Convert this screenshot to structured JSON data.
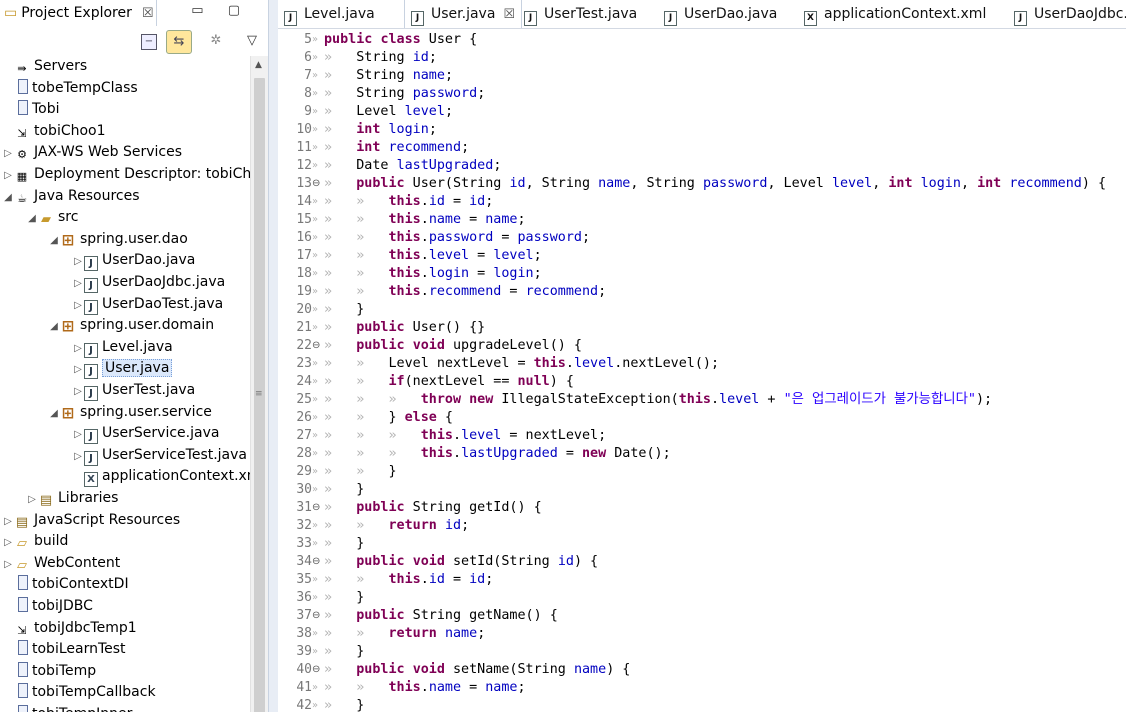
{
  "explorer": {
    "title": "Project Explorer",
    "close_glyph": "☒",
    "minmax": "▭ ▢",
    "tree": [
      {
        "label": "Servers",
        "twisty": "",
        "icon": "server",
        "depth": 0
      },
      {
        "label": "tobeTempClass",
        "twisty": "",
        "icon": "project",
        "depth": 0
      },
      {
        "label": "Tobi",
        "twisty": "",
        "icon": "project",
        "depth": 0
      },
      {
        "label": "tobiChoo1",
        "twisty": "",
        "icon": "project-web",
        "depth": 0
      },
      {
        "label": "JAX-WS Web Services",
        "twisty": "▷",
        "icon": "webservice",
        "depth": 0
      },
      {
        "label": "Deployment Descriptor: tobiCh",
        "twisty": "▷",
        "icon": "descriptor",
        "depth": 0
      },
      {
        "label": "Java Resources",
        "twisty": "◢",
        "icon": "java-resources",
        "depth": 0
      },
      {
        "label": "src",
        "twisty": "◢",
        "icon": "src-folder",
        "depth": 1
      },
      {
        "label": "spring.user.dao",
        "twisty": "◢",
        "icon": "package",
        "depth": 2
      },
      {
        "label": "UserDao.java",
        "twisty": "▷",
        "icon": "java-file",
        "depth": 3
      },
      {
        "label": "UserDaoJdbc.java",
        "twisty": "▷",
        "icon": "java-file",
        "depth": 3
      },
      {
        "label": "UserDaoTest.java",
        "twisty": "▷",
        "icon": "java-file",
        "depth": 3
      },
      {
        "label": "spring.user.domain",
        "twisty": "◢",
        "icon": "package",
        "depth": 2
      },
      {
        "label": "Level.java",
        "twisty": "▷",
        "icon": "java-file",
        "depth": 3
      },
      {
        "label": "User.java",
        "twisty": "▷",
        "icon": "java-file",
        "depth": 3,
        "selected": true
      },
      {
        "label": "UserTest.java",
        "twisty": "▷",
        "icon": "java-file",
        "depth": 3
      },
      {
        "label": "spring.user.service",
        "twisty": "◢",
        "icon": "package",
        "depth": 2
      },
      {
        "label": "UserService.java",
        "twisty": "▷",
        "icon": "java-file",
        "depth": 3
      },
      {
        "label": "UserServiceTest.java",
        "twisty": "▷",
        "icon": "java-file",
        "depth": 3
      },
      {
        "label": "applicationContext.xml",
        "twisty": "",
        "icon": "xml-file",
        "depth": 3
      },
      {
        "label": "Libraries",
        "twisty": "▷",
        "icon": "libraries",
        "depth": 1
      },
      {
        "label": "JavaScript Resources",
        "twisty": "▷",
        "icon": "js-resources",
        "depth": 0
      },
      {
        "label": "build",
        "twisty": "▷",
        "icon": "folder",
        "depth": 0
      },
      {
        "label": "WebContent",
        "twisty": "▷",
        "icon": "folder",
        "depth": 0
      },
      {
        "label": "tobiContextDI",
        "twisty": "",
        "icon": "project",
        "depth": 0
      },
      {
        "label": "tobiJDBC",
        "twisty": "",
        "icon": "project",
        "depth": 0
      },
      {
        "label": "tobiJdbcTemp1",
        "twisty": "",
        "icon": "project-web",
        "depth": 0
      },
      {
        "label": "tobiLearnTest",
        "twisty": "",
        "icon": "project",
        "depth": 0
      },
      {
        "label": "tobiTemp",
        "twisty": "",
        "icon": "project",
        "depth": 0
      },
      {
        "label": "tobiTempCallback",
        "twisty": "",
        "icon": "project",
        "depth": 0
      },
      {
        "label": "tobiTempInner",
        "twisty": "",
        "icon": "project",
        "depth": 0
      }
    ]
  },
  "editor": {
    "tabs": [
      {
        "label": "Level.java",
        "active": false,
        "icon": "java-file"
      },
      {
        "label": "User.java",
        "active": true,
        "icon": "java-file"
      },
      {
        "label": "UserTest.java",
        "active": false,
        "icon": "java-file"
      },
      {
        "label": "UserDao.java",
        "active": false,
        "icon": "java-file"
      },
      {
        "label": "applicationContext.xml",
        "active": false,
        "icon": "xml-file"
      },
      {
        "label": "UserDaoJdbc.ja",
        "active": false,
        "icon": "java-file"
      }
    ],
    "close_glyph": "☒",
    "lines": [
      {
        "n": "5",
        "fold": "",
        "t": "public class User {"
      },
      {
        "n": "6",
        "fold": "",
        "t": "    String id;"
      },
      {
        "n": "7",
        "fold": "",
        "t": "    String name;"
      },
      {
        "n": "8",
        "fold": "",
        "t": "    String password;"
      },
      {
        "n": "9",
        "fold": "",
        "t": "    Level level;"
      },
      {
        "n": "10",
        "fold": "",
        "t": "    int login;"
      },
      {
        "n": "11",
        "fold": "",
        "t": "    int recommend;"
      },
      {
        "n": "12",
        "fold": "",
        "t": "    Date lastUpgraded;"
      },
      {
        "n": "13",
        "fold": "⊖",
        "t": "    public User(String id, String name, String password, Level level, int login, int recommend) {"
      },
      {
        "n": "14",
        "fold": "",
        "t": "        this.id = id;"
      },
      {
        "n": "15",
        "fold": "",
        "t": "        this.name = name;"
      },
      {
        "n": "16",
        "fold": "",
        "t": "        this.password = password;"
      },
      {
        "n": "17",
        "fold": "",
        "t": "        this.level = level;"
      },
      {
        "n": "18",
        "fold": "",
        "t": "        this.login = login;"
      },
      {
        "n": "19",
        "fold": "",
        "t": "        this.recommend = recommend;"
      },
      {
        "n": "20",
        "fold": "",
        "t": "    }"
      },
      {
        "n": "21",
        "fold": "",
        "t": "    public User() {}"
      },
      {
        "n": "22",
        "fold": "⊖",
        "t": "    public void upgradeLevel() {"
      },
      {
        "n": "23",
        "fold": "",
        "t": "        Level nextLevel = this.level.nextLevel();"
      },
      {
        "n": "24",
        "fold": "",
        "t": "        if(nextLevel == null) {"
      },
      {
        "n": "25",
        "fold": "",
        "t": "            throw new IllegalStateException(this.level + \"은 업그레이드가 불가능합니다\");"
      },
      {
        "n": "26",
        "fold": "",
        "t": "        } else {"
      },
      {
        "n": "27",
        "fold": "",
        "t": "            this.level = nextLevel;"
      },
      {
        "n": "28",
        "fold": "",
        "t": "            this.lastUpgraded = new Date();"
      },
      {
        "n": "29",
        "fold": "",
        "t": "        }"
      },
      {
        "n": "30",
        "fold": "",
        "t": "    }"
      },
      {
        "n": "31",
        "fold": "⊖",
        "t": "    public String getId() {"
      },
      {
        "n": "32",
        "fold": "",
        "t": "        return id;"
      },
      {
        "n": "33",
        "fold": "",
        "t": "    }"
      },
      {
        "n": "34",
        "fold": "⊖",
        "t": "    public void setId(String id) {"
      },
      {
        "n": "35",
        "fold": "",
        "t": "        this.id = id;"
      },
      {
        "n": "36",
        "fold": "",
        "t": "    }"
      },
      {
        "n": "37",
        "fold": "⊖",
        "t": "    public String getName() {"
      },
      {
        "n": "38",
        "fold": "",
        "t": "        return name;"
      },
      {
        "n": "39",
        "fold": "",
        "t": "    }"
      },
      {
        "n": "40",
        "fold": "⊖",
        "t": "    public void setName(String name) {"
      },
      {
        "n": "41",
        "fold": "",
        "t": "        this.name = name;"
      },
      {
        "n": "42",
        "fold": "",
        "t": "    }"
      }
    ]
  },
  "colors": {
    "keyword": "#7f0055",
    "field": "#0000c0",
    "string": "#2a00ff",
    "line_number": "#787878",
    "selection": "#dbe8fb"
  }
}
